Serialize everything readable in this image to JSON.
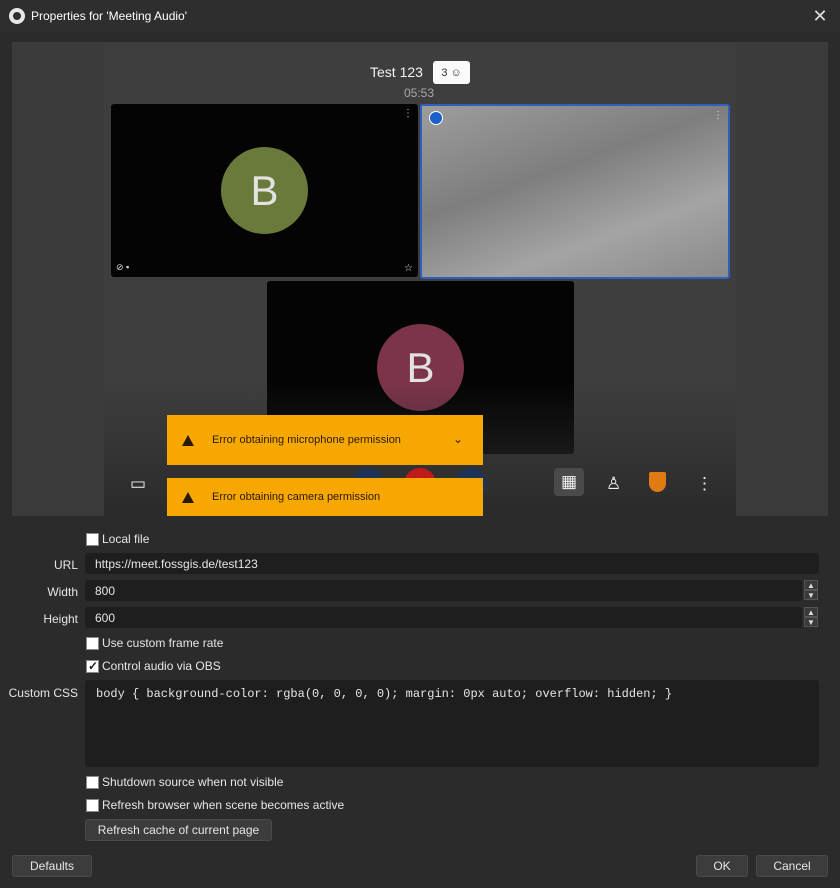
{
  "window": {
    "title": "Properties for 'Meeting Audio'"
  },
  "meeting": {
    "title": "Test 123",
    "participant_count": "3",
    "timer": "05:53",
    "tile1_initial": "B",
    "tile3_initial": "B",
    "toasts": [
      "Error obtaining microphone permission",
      "Error obtaining camera permission"
    ]
  },
  "form": {
    "local_file_label": "Local file",
    "url_label": "URL",
    "url_value": "https://meet.fossgis.de/test123",
    "width_label": "Width",
    "width_value": "800",
    "height_label": "Height",
    "height_value": "600",
    "custom_frame_rate_label": "Use custom frame rate",
    "control_audio_label": "Control audio via OBS",
    "custom_css_label": "Custom CSS",
    "custom_css_value": "body { background-color: rgba(0, 0, 0, 0); margin: 0px auto; overflow: hidden; }",
    "shutdown_label": "Shutdown source when not visible",
    "refresh_label": "Refresh browser when scene becomes active",
    "refresh_cache_button": "Refresh cache of current page"
  },
  "checkboxes": {
    "local_file": false,
    "custom_frame_rate": false,
    "control_audio": true,
    "shutdown": false,
    "refresh": false
  },
  "footer": {
    "defaults_button": "Defaults",
    "ok_button": "OK",
    "cancel_button": "Cancel"
  },
  "colors": {
    "toast": "#f7a800",
    "speaker_border": "#2f5fbf",
    "avatar_green": "#6a7a3a",
    "avatar_red": "#7c3448"
  }
}
